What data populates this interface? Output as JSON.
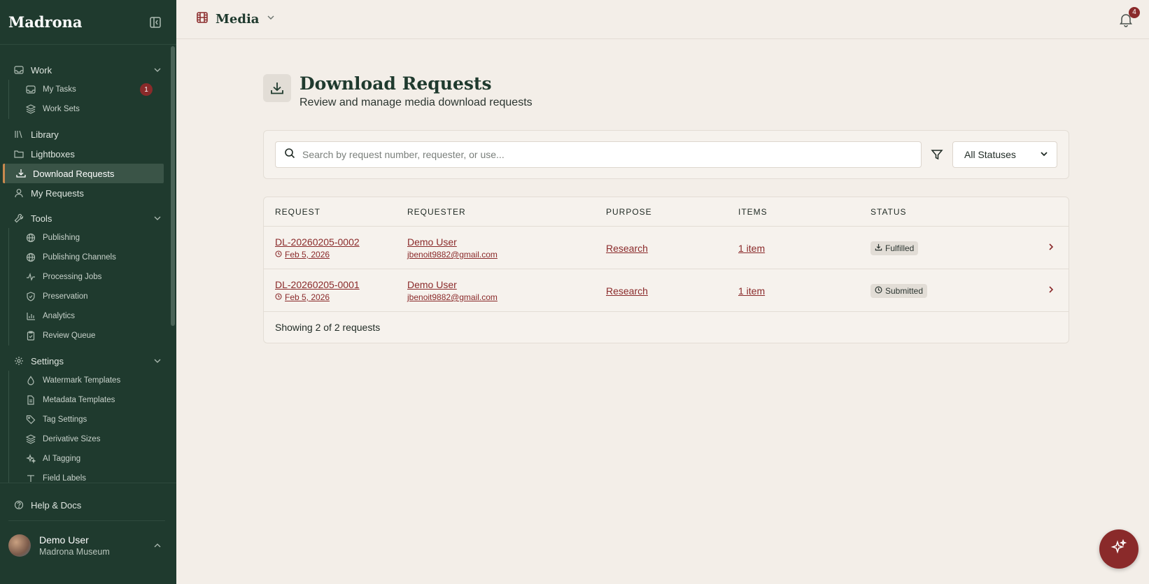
{
  "app": {
    "brand": "Madrona"
  },
  "sidebar": {
    "groups": [
      {
        "label": "Work",
        "items": [
          {
            "label": "My Tasks",
            "badge": "1"
          },
          {
            "label": "Work Sets"
          }
        ]
      },
      {
        "label": "Tools",
        "items": [
          {
            "label": "Publishing"
          },
          {
            "label": "Publishing Channels"
          },
          {
            "label": "Processing Jobs"
          },
          {
            "label": "Preservation"
          },
          {
            "label": "Analytics"
          },
          {
            "label": "Review Queue"
          }
        ]
      },
      {
        "label": "Settings",
        "items": [
          {
            "label": "Watermark Templates"
          },
          {
            "label": "Metadata Templates"
          },
          {
            "label": "Tag Settings"
          },
          {
            "label": "Derivative Sizes"
          },
          {
            "label": "AI Tagging"
          },
          {
            "label": "Field Labels"
          }
        ]
      }
    ],
    "top_items": [
      {
        "label": "Library"
      },
      {
        "label": "Lightboxes"
      },
      {
        "label": "Download Requests"
      },
      {
        "label": "My Requests"
      }
    ],
    "help": "Help & Docs",
    "user": {
      "name": "Demo User",
      "org": "Madrona Museum"
    }
  },
  "topbar": {
    "section": "Media",
    "notifications": "4"
  },
  "page": {
    "title": "Download Requests",
    "subtitle": "Review and manage media download requests"
  },
  "search": {
    "placeholder": "Search by request number, requester, or use..."
  },
  "status_filter": {
    "selected": "All Statuses"
  },
  "table": {
    "headers": {
      "request": "REQUEST",
      "requester": "REQUESTER",
      "purpose": "PURPOSE",
      "items": "ITEMS",
      "status": "STATUS"
    },
    "rows": [
      {
        "id": "DL-20260205-0002",
        "date": "Feb 5, 2026",
        "requester": "Demo User",
        "email": "jbenoit9882@gmail.com",
        "purpose": "Research",
        "items": "1 item",
        "status": "Fulfilled"
      },
      {
        "id": "DL-20260205-0001",
        "date": "Feb 5, 2026",
        "requester": "Demo User",
        "email": "jbenoit9882@gmail.com",
        "purpose": "Research",
        "items": "1 item",
        "status": "Submitted"
      }
    ],
    "footer": "Showing 2 of 2 requests"
  },
  "colors": {
    "sidebar_bg": "#1f3a2e",
    "accent": "#8a2a2a",
    "page_bg": "#f3eee8",
    "active_border": "#c9894e"
  }
}
